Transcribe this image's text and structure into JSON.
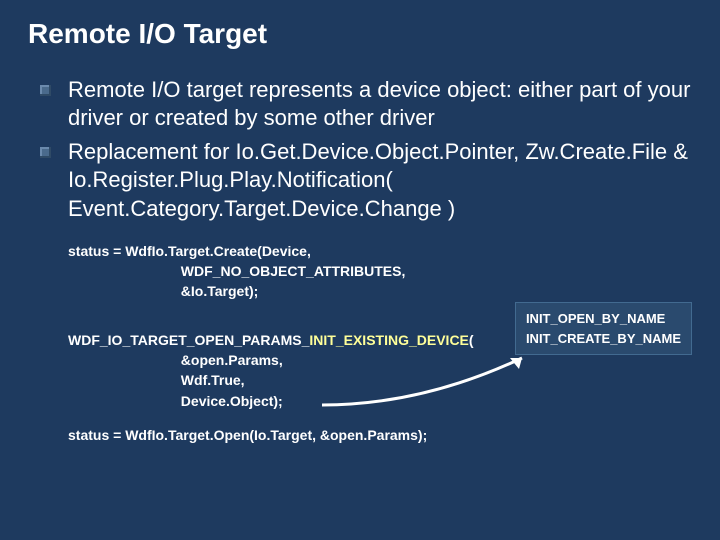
{
  "title": "Remote I/O Target",
  "bullets": [
    "Remote I/O target represents a device object: either part of your driver or created by some other driver",
    "Replacement for Io.Get.Device.Object.Pointer, Zw.Create.File & Io.Register.Plug.Play.Notification( Event.Category.Target.Device.Change )"
  ],
  "code": {
    "line1": "status = WdfIo.Target.Create(Device,",
    "line2": "                             WDF_NO_OBJECT_ATTRIBUTES,",
    "line3": "                             &Io.Target);",
    "line4_prefix": "WDF_IO_TARGET_OPEN_PARAMS_",
    "line4_highlight": "INIT_EXISTING_DEVICE",
    "line4_suffix": "(",
    "line5": "                             &open.Params,",
    "line6": "                             Wdf.True,",
    "line7": "                             Device.Object);",
    "line8": "status = WdfIo.Target.Open(Io.Target, &open.Params);"
  },
  "aside": {
    "line1": "INIT_OPEN_BY_NAME",
    "line2": "INIT_CREATE_BY_NAME"
  }
}
